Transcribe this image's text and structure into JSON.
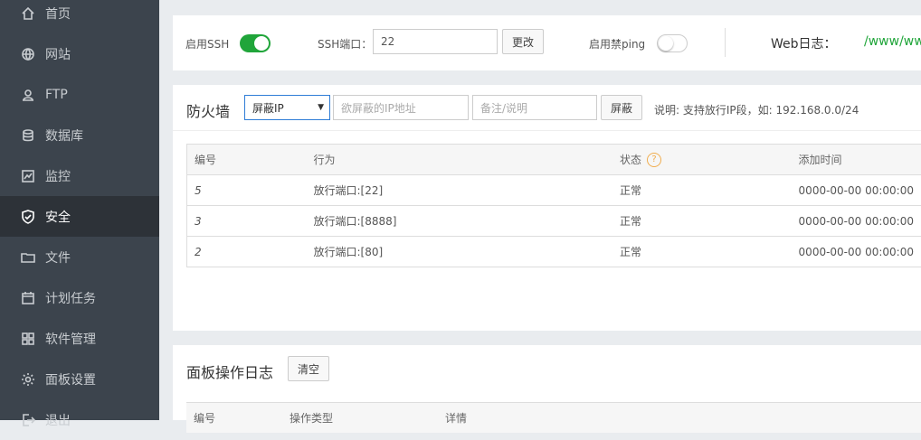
{
  "sidebar": {
    "items": [
      {
        "label": "首页",
        "icon": "home-icon",
        "active": false
      },
      {
        "label": "网站",
        "icon": "globe-icon",
        "active": false
      },
      {
        "label": "FTP",
        "icon": "ftp-icon",
        "active": false
      },
      {
        "label": "数据库",
        "icon": "database-icon",
        "active": false
      },
      {
        "label": "监控",
        "icon": "monitor-icon",
        "active": false
      },
      {
        "label": "安全",
        "icon": "shield-icon",
        "active": true
      },
      {
        "label": "文件",
        "icon": "folder-icon",
        "active": false
      },
      {
        "label": "计划任务",
        "icon": "calendar-icon",
        "active": false
      },
      {
        "label": "软件管理",
        "icon": "grid-icon",
        "active": false
      },
      {
        "label": "面板设置",
        "icon": "gear-icon",
        "active": false
      },
      {
        "label": "退出",
        "icon": "logout-icon",
        "active": false
      }
    ]
  },
  "ssh": {
    "enable_label": "启用SSH",
    "enable_on": true,
    "port_label": "SSH端口：",
    "port_value": "22",
    "change_btn": "更改",
    "ping_label": "启用禁ping",
    "ping_on": false,
    "weblog_label": "Web日志：",
    "weblog_path": "/www/wwwlogs"
  },
  "firewall": {
    "title": "防火墙",
    "select_value": "屏蔽IP",
    "ip_placeholder": "欲屏蔽的IP地址",
    "note_placeholder": "备注/说明",
    "block_btn": "屏蔽",
    "hint": "说明: 支持放行IP段，如: 192.168.0.0/24",
    "columns": [
      "编号",
      "行为",
      "状态",
      "添加时间"
    ],
    "rows": [
      {
        "id": "5",
        "action": "放行端口:[22]",
        "status": "正常",
        "time": "0000-00-00 00:00:00"
      },
      {
        "id": "3",
        "action": "放行端口:[8888]",
        "status": "正常",
        "time": "0000-00-00 00:00:00"
      },
      {
        "id": "2",
        "action": "放行端口:[80]",
        "status": "正常",
        "time": "0000-00-00 00:00:00"
      }
    ]
  },
  "log": {
    "title": "面板操作日志",
    "clear_btn": "清空",
    "columns": [
      "编号",
      "操作类型",
      "详情"
    ]
  },
  "colors": {
    "accent_green": "#20a53a",
    "sidebar_bg": "#3c444d",
    "active_bg": "#2d3238",
    "help_orange": "#f0ad4e"
  }
}
